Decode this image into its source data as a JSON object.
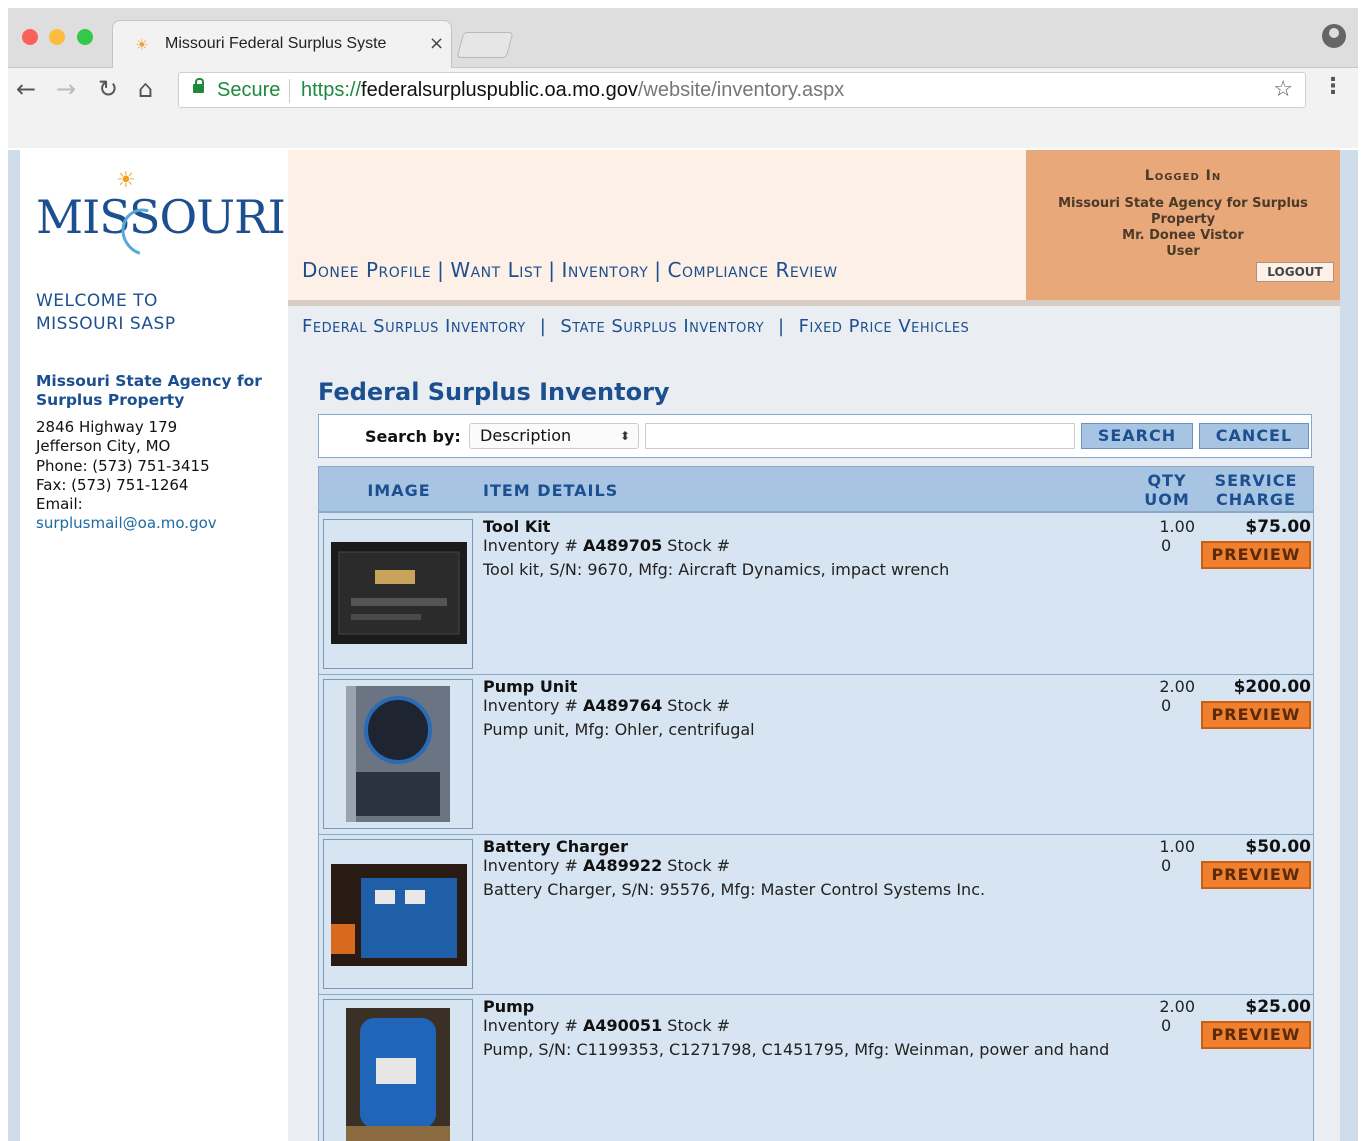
{
  "browser": {
    "tab_title": "Missouri Federal Surplus Syste",
    "url_protocol": "https://",
    "url_host": "federalsurpluspublic.oa.mo.gov",
    "url_path": "/website/inventory.aspx",
    "secure_label": "Secure",
    "icons": [
      "back-icon",
      "forward-icon",
      "reload-icon",
      "home-icon",
      "lock-icon",
      "star-icon",
      "menu-icon",
      "profile-icon"
    ]
  },
  "sidebar": {
    "logo_text": "MISSOURI",
    "welcome_line1": "WELCOME TO",
    "welcome_line2": "MISSOURI SASP",
    "agency_name": "Missouri State Agency for Surplus Property",
    "address1": "2846 Highway 179",
    "address2": "Jefferson City, MO",
    "phone": "Phone: (573) 751-3415",
    "fax": "Fax: (573) 751-1264",
    "email_label": "Email:",
    "email": "surplusmail@oa.mo.gov"
  },
  "header": {
    "nav": [
      "Donee Profile",
      "Want List",
      "Inventory",
      "Compliance Review"
    ],
    "logged_in_title": "Logged In",
    "logged_in_org1": "Missouri State Agency for Surplus",
    "logged_in_org2": "Property",
    "logged_in_user": "Mr. Donee Vistor",
    "logged_in_role": "User",
    "logout_label": "LOGOUT"
  },
  "subnav": [
    "Federal Surplus Inventory",
    "State Surplus Inventory",
    "Fixed Price Vehicles"
  ],
  "main": {
    "title": "Federal Surplus Inventory",
    "search_label": "Search by:",
    "search_option": "Description",
    "search_button": "SEARCH",
    "cancel_button": "CANCEL",
    "columns": {
      "image": "IMAGE",
      "details": "ITEM DETAILS",
      "qty": "QTY",
      "uom": "UOM",
      "service": "SERVICE",
      "charge": "CHARGE"
    },
    "items": [
      {
        "name": "Tool Kit",
        "inv_label": "Inventory #",
        "inv": "A489705",
        "stock_label": "Stock #",
        "desc": "Tool kit, S/N: 9670, Mfg: Aircraft Dynamics, impact wrench",
        "qty": "1.00",
        "uom": "0",
        "price": "$75.00",
        "preview": "PREVIEW"
      },
      {
        "name": "Pump Unit",
        "inv_label": "Inventory #",
        "inv": "A489764",
        "stock_label": "Stock #",
        "desc": "Pump unit, Mfg: Ohler, centrifugal",
        "qty": "2.00",
        "uom": "0",
        "price": "$200.00",
        "preview": "PREVIEW"
      },
      {
        "name": "Battery Charger",
        "inv_label": "Inventory #",
        "inv": "A489922",
        "stock_label": "Stock #",
        "desc": "Battery Charger, S/N: 95576, Mfg: Master Control Systems Inc.",
        "qty": "1.00",
        "uom": "0",
        "price": "$50.00",
        "preview": "PREVIEW"
      },
      {
        "name": "Pump",
        "inv_label": "Inventory #",
        "inv": "A490051",
        "stock_label": "Stock #",
        "desc": "Pump, S/N: C1199353, C1271798, C1451795, Mfg: Weinman, power and hand",
        "qty": "2.00",
        "uom": "0",
        "price": "$25.00",
        "preview": "PREVIEW"
      }
    ]
  }
}
